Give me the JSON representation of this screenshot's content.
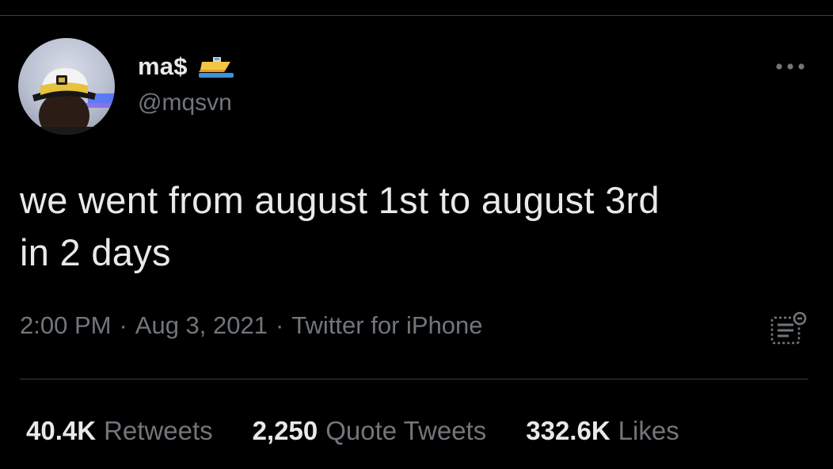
{
  "tweet": {
    "author": {
      "display_name": "ma$",
      "name_emoji": "speedboat-emoji",
      "handle": "@mqsvn",
      "avatar": "avatar-photo"
    },
    "text_line1": "we went from august 1st to august 3rd",
    "text_line2": "in 2 days",
    "meta": {
      "time": "2:00 PM",
      "separator": "·",
      "date": "Aug 3, 2021",
      "source": "Twitter for iPhone"
    },
    "stats": {
      "retweets_value": "40.4K",
      "retweets_label": "Retweets",
      "quotes_value": "2,250",
      "quotes_label": "Quote Tweets",
      "likes_value": "332.6K",
      "likes_label": "Likes"
    }
  },
  "icons": {
    "more": "more-horizontal-icon",
    "analytics": "view-analytics-icon"
  },
  "colors": {
    "background": "#000000",
    "primary_text": "#e7e9ea",
    "secondary_text": "#71767b",
    "divider": "#3a3d40"
  }
}
